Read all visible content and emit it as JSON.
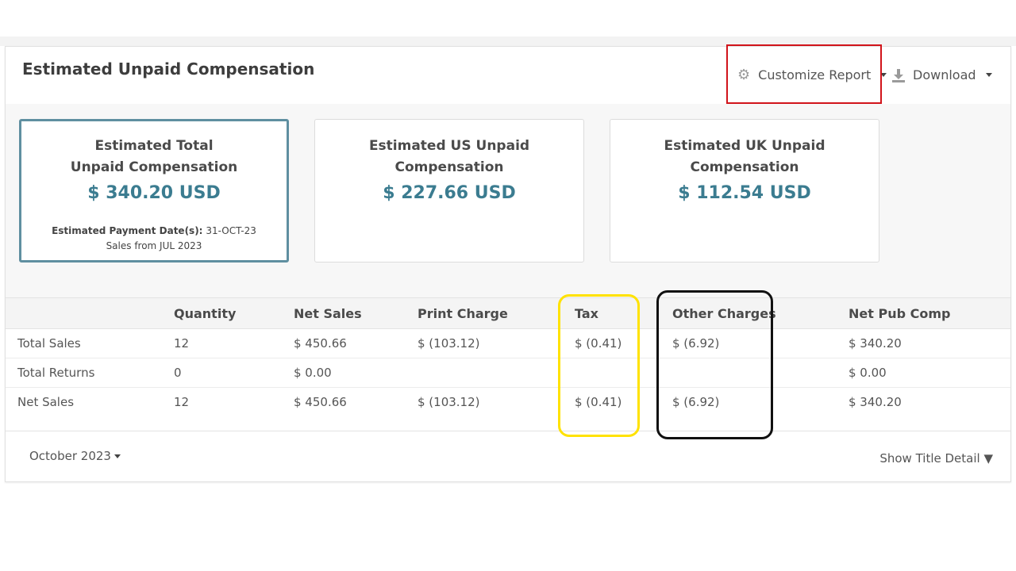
{
  "header": {
    "title": "Estimated Unpaid Compensation",
    "customize_label": "Customize Report",
    "download_label": "Download"
  },
  "cards": [
    {
      "title": "Estimated Total Unpaid Compensation",
      "amount": "$ 340.20 USD",
      "payment_label": "Estimated Payment Date(s):",
      "payment_date": "31-OCT-23",
      "sales_from": "Sales from JUL 2023"
    },
    {
      "title": "Estimated US Unpaid Compensation",
      "amount": "$ 227.66 USD"
    },
    {
      "title": "Estimated UK Unpaid Compensation",
      "amount": "$ 112.54 USD"
    }
  ],
  "table": {
    "headers": [
      "",
      "Quantity",
      "Net Sales",
      "Print Charge",
      "Tax",
      "Other Charges",
      "Net Pub Comp"
    ],
    "rows": [
      [
        "Total Sales",
        "12",
        "$ 450.66",
        "$ (103.12)",
        "$ (0.41)",
        "$ (6.92)",
        "$ 340.20"
      ],
      [
        "Total Returns",
        "0",
        "$ 0.00",
        "",
        "",
        "",
        "$ 0.00"
      ],
      [
        "Net Sales",
        "12",
        "$ 450.66",
        "$ (103.12)",
        "$ (0.41)",
        "$ (6.92)",
        "$ 340.20"
      ]
    ]
  },
  "footer": {
    "month_label": "October 2023",
    "show_detail_label": "Show Title Detail ▼"
  },
  "colors": {
    "accent": "#3b7c90",
    "highlight_red": "#d1141b",
    "highlight_yellow": "#ffe200",
    "highlight_black": "#111111"
  }
}
